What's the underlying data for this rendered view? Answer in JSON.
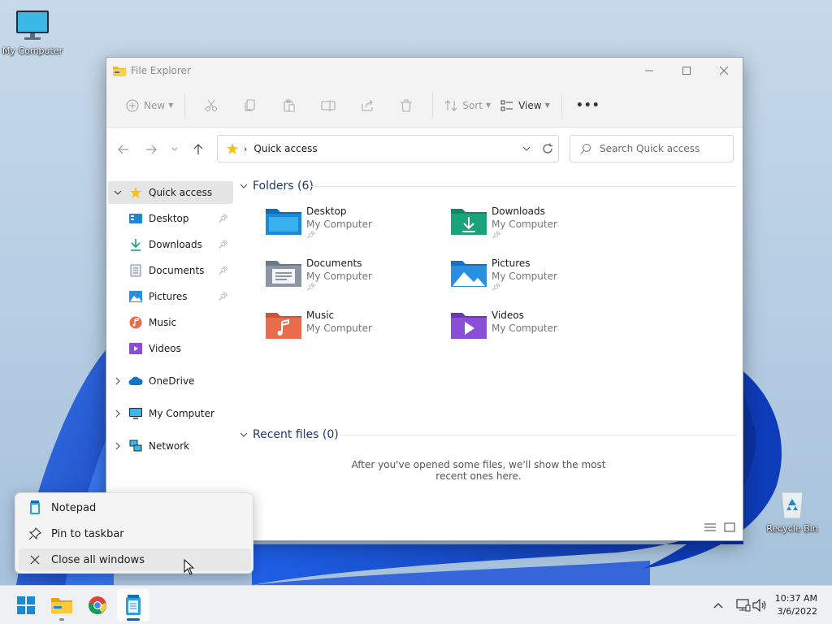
{
  "desktop": {
    "icons": [
      {
        "label": "My Computer",
        "icon": "monitor-icon"
      },
      {
        "label": "Recycle Bin",
        "icon": "recycle-bin-icon"
      }
    ]
  },
  "window": {
    "title": "File Explorer",
    "controls": [
      "minimize",
      "maximize",
      "close"
    ]
  },
  "commandbar": {
    "new_label": "New",
    "sort_label": "Sort",
    "view_label": "View",
    "icons": [
      "cut-icon",
      "copy-icon",
      "paste-icon",
      "rename-icon",
      "share-icon",
      "delete-icon"
    ],
    "more_label": "•••"
  },
  "navigation": {
    "address_path": "Quick access",
    "search_placeholder": "Search Quick access"
  },
  "sidebar": {
    "items": [
      {
        "label": "Quick access",
        "icon": "star-icon",
        "expanded": true,
        "selected": true
      },
      {
        "label": "Desktop",
        "icon": "desktop-folder-icon",
        "pinned": true
      },
      {
        "label": "Downloads",
        "icon": "download-icon",
        "pinned": true
      },
      {
        "label": "Documents",
        "icon": "documents-icon",
        "pinned": true
      },
      {
        "label": "Pictures",
        "icon": "pictures-icon",
        "pinned": true
      },
      {
        "label": "Music",
        "icon": "music-icon"
      },
      {
        "label": "Videos",
        "icon": "videos-icon"
      },
      {
        "label": "OneDrive",
        "icon": "cloud-icon",
        "expanded": false
      },
      {
        "label": "My Computer",
        "icon": "monitor-icon",
        "expanded": false
      },
      {
        "label": "Network",
        "icon": "network-icon",
        "expanded": false
      }
    ]
  },
  "content": {
    "folders_header": "Folders (6)",
    "folders": [
      {
        "name": "Desktop",
        "location": "My Computer",
        "pinned": true,
        "color": "#1a8ad4"
      },
      {
        "name": "Downloads",
        "location": "My Computer",
        "pinned": true,
        "color": "#1aa37a"
      },
      {
        "name": "Documents",
        "location": "My Computer",
        "pinned": true,
        "color": "#7d8a99"
      },
      {
        "name": "Pictures",
        "location": "My Computer",
        "pinned": true,
        "color": "#2a8fe0"
      },
      {
        "name": "Music",
        "location": "My Computer",
        "pinned": false,
        "color": "#e86d4a"
      },
      {
        "name": "Videos",
        "location": "My Computer",
        "pinned": false,
        "color": "#8a4fd8"
      }
    ],
    "recent_header": "Recent files (0)",
    "recent_empty": "After you've opened some files, we'll show the most recent ones here."
  },
  "jumplist": {
    "items": [
      {
        "label": "Notepad",
        "icon": "notepad-icon"
      },
      {
        "label": "Pin to taskbar",
        "icon": "pin-icon"
      },
      {
        "label": "Close all windows",
        "icon": "close-icon"
      }
    ]
  },
  "taskbar": {
    "apps": [
      "start-icon",
      "file-explorer-icon",
      "chrome-icon",
      "notepad-icon"
    ],
    "time": "10:37 AM",
    "date": "3/6/2022"
  }
}
